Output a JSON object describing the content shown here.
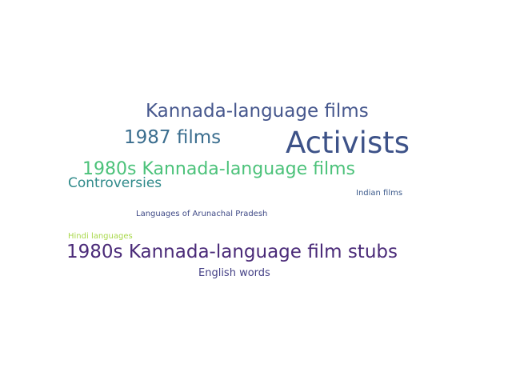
{
  "words": [
    {
      "text": "Kannada-language films",
      "color": "#46578d"
    },
    {
      "text": "1987 films",
      "color": "#3a6d8e"
    },
    {
      "text": "Activists",
      "color": "#3d5288"
    },
    {
      "text": "1980s Kannada-language films",
      "color": "#4cc27a"
    },
    {
      "text": "Controversies",
      "color": "#2f8a8a"
    },
    {
      "text": "Indian films",
      "color": "#3d5b8c"
    },
    {
      "text": "Languages of Arunachal Pradesh",
      "color": "#3f4a86"
    },
    {
      "text": "Hindi languages",
      "color": "#a8d84a"
    },
    {
      "text": "1980s Kannada-language film stubs",
      "color": "#4a2a78"
    },
    {
      "text": "English words",
      "color": "#433f85"
    }
  ]
}
